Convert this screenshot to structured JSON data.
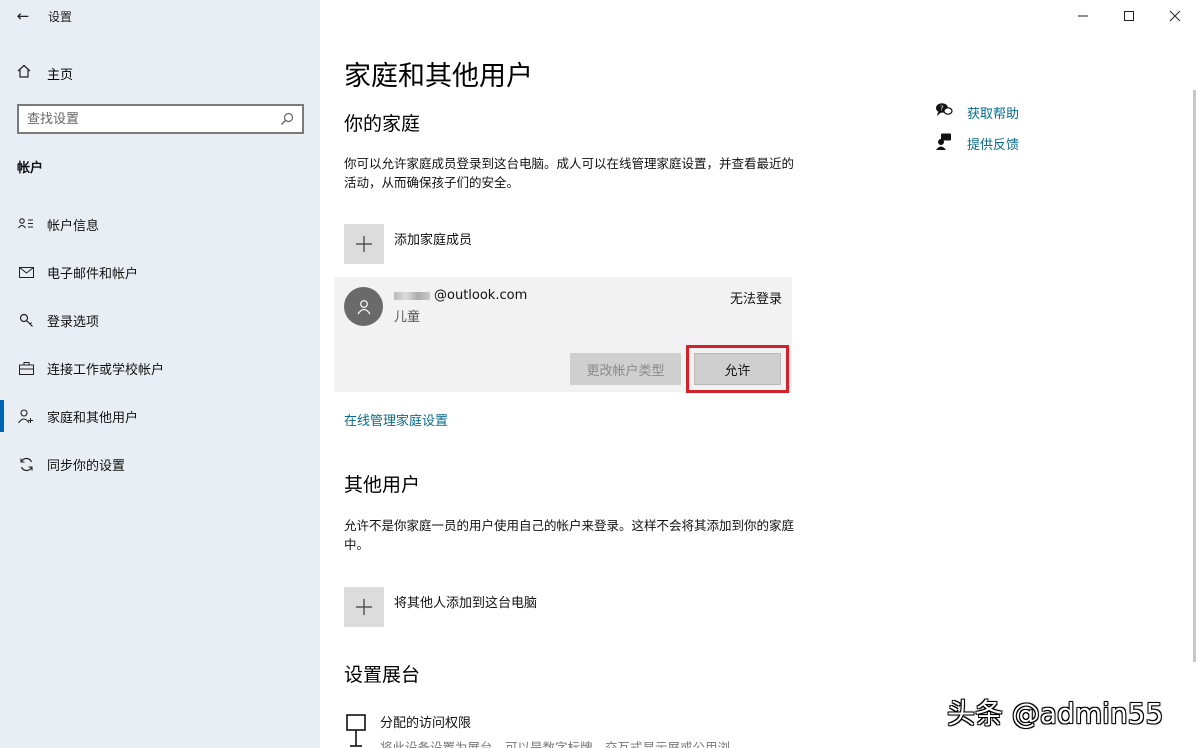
{
  "window": {
    "back_glyph": "←",
    "title": "设置",
    "controls": {
      "minimize": "—",
      "maximize": "☐",
      "close": "✕"
    }
  },
  "sidebar": {
    "home_label": "主页",
    "search_placeholder": "查找设置",
    "section_label": "帐户",
    "items": [
      {
        "label": "帐户信息",
        "icon": "account-info-icon",
        "glyph": "ጸ"
      },
      {
        "label": "电子邮件和帐户",
        "icon": "mail-icon",
        "glyph": "✉"
      },
      {
        "label": "登录选项",
        "icon": "key-icon",
        "glyph": "⚲"
      },
      {
        "label": "连接工作或学校帐户",
        "icon": "briefcase-icon",
        "glyph": "⊟"
      },
      {
        "label": "家庭和其他用户",
        "icon": "person-add-icon",
        "glyph": "⚇"
      },
      {
        "label": "同步你的设置",
        "icon": "sync-icon",
        "glyph": "↻"
      }
    ],
    "active_index": 4
  },
  "main": {
    "title": "家庭和其他用户",
    "family": {
      "heading": "你的家庭",
      "description": "你可以允许家庭成员登录到这台电脑。成人可以在线管理家庭设置，并查看最近的活动，从而确保孩子们的安全。",
      "add_label": "添加家庭成员",
      "member": {
        "email_suffix": "@outlook.com",
        "role": "儿童",
        "status": "无法登录",
        "change_type_label": "更改帐户类型",
        "allow_label": "允许"
      },
      "manage_link": "在线管理家庭设置"
    },
    "others": {
      "heading": "其他用户",
      "description": "允许不是你家庭一员的用户使用自己的帐户来登录。这样不会将其添加到你的家庭中。",
      "add_label": "将其他人添加到这台电脑"
    },
    "kiosk": {
      "heading": "设置展台",
      "item_title": "分配的访问权限",
      "item_desc": "将此设备设置为展台 - 可以是数字标牌、交互式显示屏或公用浏"
    }
  },
  "help": {
    "get_help": "获取帮助",
    "feedback": "提供反馈"
  },
  "watermark": "头条 @admin55",
  "colors": {
    "sidebar_bg": "#e9eef4",
    "link": "#0a6b8a",
    "highlight_border": "#d3212b",
    "accent": "#0063b1"
  }
}
